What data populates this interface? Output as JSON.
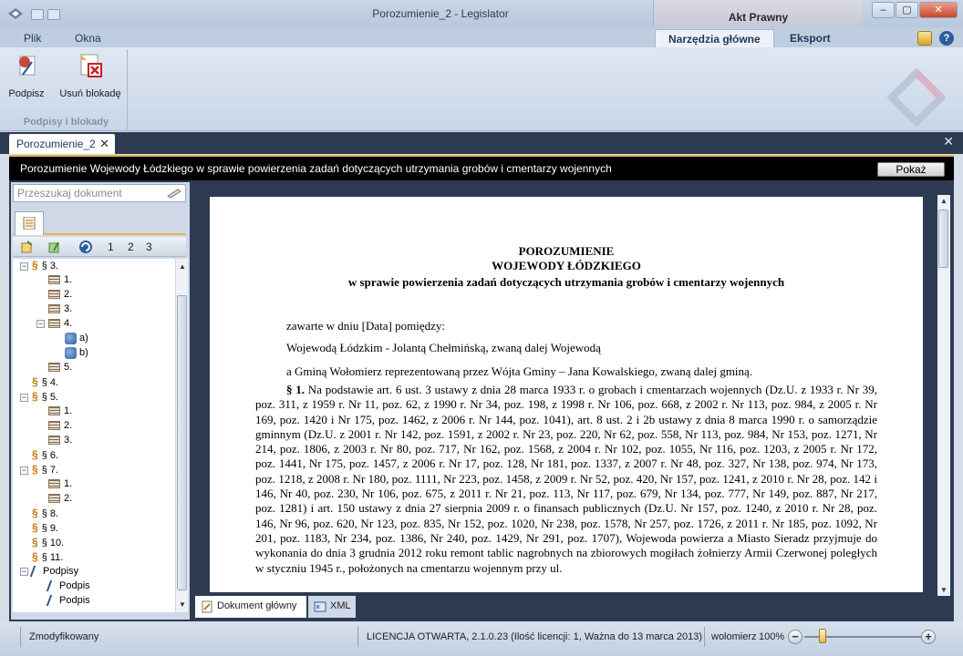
{
  "window": {
    "title": "Porozumienie_2 - Legislator",
    "context_tab_title": "Akt Prawny"
  },
  "menu": {
    "plik": "Plik",
    "okna": "Okna"
  },
  "ribbon_tabs": [
    {
      "label": "Narzędzia główne",
      "active": true
    },
    {
      "label": "Eksport",
      "active": false
    }
  ],
  "ribbon": {
    "group_label": "Podpisy i blokady",
    "buttons": [
      {
        "label": "Podpisz",
        "icon": "sign-icon"
      },
      {
        "label": "Usuń blokadę",
        "icon": "remove-lock-icon"
      }
    ]
  },
  "document_tab": {
    "label": "Porozumienie_2"
  },
  "header": {
    "title": "Porozumienie Wojewody Łódzkiego w sprawie powierzenia zadań dotyczących utrzymania grobów i cmentarzy wojennych",
    "show_button": "Pokaż"
  },
  "search": {
    "placeholder": "Przeszukaj dokument"
  },
  "tree_tools": {
    "levels": [
      "1",
      "2",
      "3"
    ]
  },
  "tree": [
    {
      "label": "§ 3.",
      "type": "para",
      "level": 0,
      "toggle": "−"
    },
    {
      "label": "1.",
      "type": "point",
      "level": 1
    },
    {
      "label": "2.",
      "type": "point",
      "level": 1
    },
    {
      "label": "3.",
      "type": "point",
      "level": 1
    },
    {
      "label": "4.",
      "type": "point",
      "level": 1,
      "toggle": "−"
    },
    {
      "label": "a)",
      "type": "letter",
      "level": 2
    },
    {
      "label": "b)",
      "type": "letter",
      "level": 2
    },
    {
      "label": "5.",
      "type": "point",
      "level": 1
    },
    {
      "label": "§ 4.",
      "type": "para",
      "level": 0
    },
    {
      "label": "§ 5.",
      "type": "para",
      "level": 0,
      "toggle": "−"
    },
    {
      "label": "1.",
      "type": "point",
      "level": 1
    },
    {
      "label": "2.",
      "type": "point",
      "level": 1
    },
    {
      "label": "3.",
      "type": "point",
      "level": 1
    },
    {
      "label": "§ 6.",
      "type": "para",
      "level": 0
    },
    {
      "label": "§ 7.",
      "type": "para",
      "level": 0,
      "toggle": "−"
    },
    {
      "label": "1.",
      "type": "point",
      "level": 1
    },
    {
      "label": "2.",
      "type": "point",
      "level": 1
    },
    {
      "label": "§ 8.",
      "type": "para",
      "level": 0
    },
    {
      "label": "§ 9.",
      "type": "para",
      "level": 0
    },
    {
      "label": "§ 10.",
      "type": "para",
      "level": 0
    },
    {
      "label": "§ 11.",
      "type": "para",
      "level": 0
    },
    {
      "label": "Podpisy",
      "type": "sign",
      "level": 0,
      "toggle": "−"
    },
    {
      "label": "Podpis",
      "type": "sign",
      "level": 1
    },
    {
      "label": "Podpis",
      "type": "sign",
      "level": 1
    }
  ],
  "document": {
    "title_lines": [
      "POROZUMIENIE",
      "WOJEWODY ŁÓDZKIEGO",
      "w sprawie powierzenia zadań dotyczących utrzymania grobów i cmentarzy wojennych"
    ],
    "intro_lines": [
      "zawarte w dniu [Data] pomiędzy:",
      "Wojewodą Łódzkim - Jolantą Chełmińską, zwaną dalej Wojewodą",
      "a Gminą Wołomierz reprezentowaną przez Wójta Gminy – Jana Kowalskiego, zwaną dalej gminą."
    ],
    "paragraph_label": "§ 1.",
    "paragraph_text": " Na podstawie art. 6 ust. 3 ustawy z dnia 28 marca 1933 r. o grobach i cmentarzach wojennych (Dz.U. z 1933 r. Nr 39, poz. 311, z 1959 r. Nr 11, poz. 62, z 1990 r. Nr 34, poz. 198, z 1998 r. Nr 106, poz. 668, z 2002 r. Nr 113, poz. 984, z 2005 r. Nr 169, poz. 1420 i Nr 175, poz. 1462, z 2006 r. Nr 144, poz. 1041), art. 8 ust. 2 i 2b ustawy z dnia 8 marca 1990 r. o samorządzie gminnym (Dz.U. z 2001 r. Nr 142, poz. 1591, z 2002 r. Nr 23, poz. 220, Nr 62, poz. 558, Nr 113, poz. 984, Nr 153, poz. 1271, Nr 214, poz. 1806, z 2003 r. Nr 80, poz. 717, Nr 162, poz. 1568, z 2004 r. Nr 102, poz. 1055, Nr 116, poz. 1203, z 2005 r. Nr 172, poz. 1441, Nr 175, poz. 1457, z 2006 r. Nr 17, poz. 128, Nr 181, poz. 1337, z 2007 r. Nr 48, poz. 327, Nr 138, poz. 974, Nr 173, poz. 1218, z 2008 r. Nr 180, poz. 1111, Nr 223, poz. 1458, z 2009 r. Nr 52, poz. 420, Nr 157, poz. 1241, z 2010 r. Nr 28, poz. 142 i 146, Nr 40, poz. 230, Nr 106, poz. 675, z 2011 r. Nr 21, poz. 113, Nr 117, poz. 679, Nr 134, poz. 777, Nr 149, poz. 887, Nr 217, poz. 1281) i art. 150 ustawy z dnia 27 sierpnia 2009 r. o finansach publicznych (Dz.U. Nr 157, poz. 1240, z 2010 r. Nr 28, poz. 146, Nr 96, poz. 620, Nr 123, poz. 835, Nr 152, poz. 1020, Nr 238, poz. 1578, Nr 257, poz. 1726, z 2011 r. Nr 185, poz. 1092, Nr 201, poz. 1183, Nr 234, poz. 1386, Nr 240, poz. 1429, Nr 291, poz. 1707), Wojewoda powierza a Miasto Sieradz przyjmuje do wykonania do dnia 3 grudnia 2012 roku remont tablic nagrobnych na zbiorowych mogiłach żołnierzy Armii Czerwonej poległych w styczniu 1945 r., położonych na cmentarzu wojennym przy ul."
  },
  "bottom_tabs": [
    {
      "label": "Dokument główny",
      "active": true
    },
    {
      "label": "XML",
      "active": false
    }
  ],
  "status": {
    "state": "Zmodyfikowany",
    "license": "LICENCJA OTWARTA, 2.1.0.23 (Ilość licencji: 1, Ważna do 13 marca 2013)",
    "location": "wolomierz",
    "zoom": "100%",
    "zoom_level": 0.15
  },
  "colors": {
    "accent": "#e3b64b",
    "frame": "#2d3b52"
  }
}
